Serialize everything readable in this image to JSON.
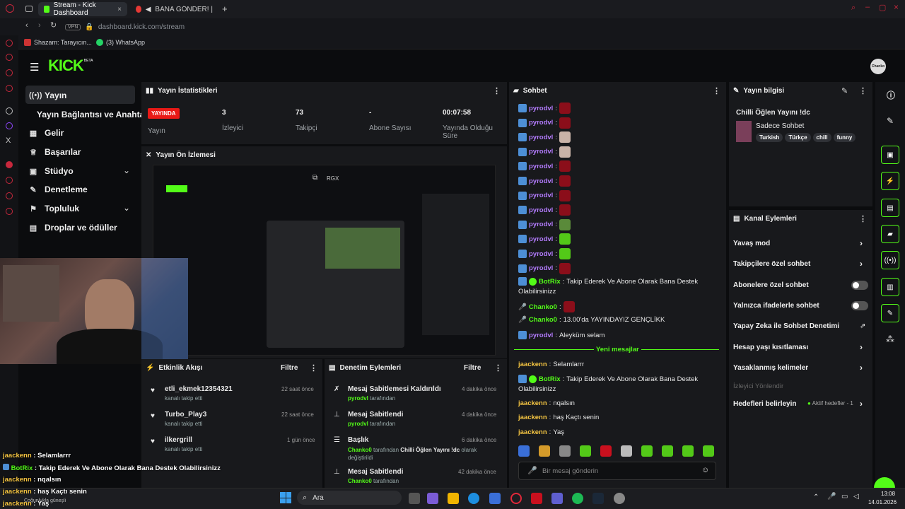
{
  "browser": {
    "tab1": "Stream - Kick Dashboard",
    "tab2": "BANA GÖNDER! | YouT",
    "url": "dashboard.kick.com/stream",
    "vpn": "VPN",
    "bookmark1": "Shazam: Tarayıcın...",
    "bookmark2": "(3) WhatsApp"
  },
  "logo": "KICK",
  "logo_beta": "BETA",
  "avatar": "Chanko",
  "nav": {
    "stream": "Yayın",
    "connection": "Yayın Bağlantısı ve Anahtarı",
    "income": "Gelir",
    "achievements": "Başarılar",
    "studio": "Stüdyo",
    "moderation": "Denetleme",
    "community": "Topluluk",
    "drops": "Droplar ve ödüller"
  },
  "stats": {
    "title": "Yayın İstatistikleri",
    "live_badge": "YAYINDA",
    "status_label": "Yayın",
    "viewers_value": "3",
    "viewers_label": "İzleyici",
    "followers_value": "73",
    "followers_label": "Takipçi",
    "subs_value": "-",
    "subs_label": "Abone Sayısı",
    "duration_value": "00:07:58",
    "duration_label": "Yayında Olduğu Süre"
  },
  "preview": {
    "title": "Yayın Ön İzlemesi",
    "rgx": "RGX"
  },
  "activity": {
    "title": "Etkinlik Akışı",
    "filter": "Filtre",
    "items": [
      {
        "user": "etli_ekmek12354321",
        "action": "kanalı takip etti",
        "time": "22 saat önce"
      },
      {
        "user": "Turbo_Play3",
        "action": "kanalı takip etti",
        "time": "22 saat önce"
      },
      {
        "user": "ilkergrill",
        "action": "kanalı takip etti",
        "time": "1 gün önce"
      }
    ]
  },
  "modactions": {
    "title": "Denetim Eylemleri",
    "filter": "Filtre",
    "items": [
      {
        "title": "Mesaj Sabitlemesi Kaldırıldı",
        "by": "pyrodvl",
        "suffix": "tarafından",
        "time": "4 dakika önce"
      },
      {
        "title": "Mesaj Sabitlendi",
        "by": "pyrodvl",
        "suffix": "tarafından",
        "time": "4 dakika önce"
      },
      {
        "title": "Başlık",
        "by": "Chanko0",
        "suffix": "tarafından",
        "extra": "Chilli Öğlen Yayını !dc",
        "extra2": "olarak",
        "extra3": "değiştirildi",
        "time": "6 dakika önce"
      },
      {
        "title": "Mesaj Sabitlendi",
        "by": "Chanko0",
        "suffix": "tarafından",
        "time": "42 dakika önce"
      }
    ]
  },
  "chat": {
    "title": "Sohbet",
    "pyro": "pyrodvl",
    "botrix": "BotRix",
    "botmsg1": "Takip Ederek Ve Abone Olarak Bana Destek",
    "botmsg2": "Olabilirsinizz",
    "chanko": "Chanko0",
    "chanko_msg": "13.00'da YAYINDAYIZ GENÇLİKK",
    "pyro_msg": "Aleyküm selam",
    "new_msgs": "Yeni mesajlar",
    "jaeckenn": "jaackenn",
    "m1": "Selamlarrr",
    "m3": "nqalsın",
    "m4": "haş Kaçtı senin",
    "m5": "Yaş",
    "placeholder": "Bir mesaj gönderin"
  },
  "info": {
    "title": "Yayın bilgisi",
    "stream_title": "Chilli Öğlen Yayını !dc",
    "category": "Sadece Sohbet",
    "tags": [
      "Turkish",
      "Türkçe",
      "chill",
      "funny"
    ]
  },
  "channel": {
    "title": "Kanal Eylemleri",
    "slow": "Yavaş mod",
    "followers": "Takipçilere özel sohbet",
    "subs": "Abonelere özel sohbet",
    "emotes": "Yalnızca ifadelerle sohbet",
    "ai": "Yapay Zeka ile Sohbet Denetimi",
    "age": "Hesap yaşı kısıtlaması",
    "banned": "Yasaklanmış kelimeler",
    "redirect": "İzleyici Yönlendir",
    "goals": "Hedefleri belirleyin",
    "goals_status": "Aktif hedefler - 1"
  },
  "overlay": {
    "l1u": "jaackenn",
    "l1": "Selamlarrr",
    "l2u": "BotRix",
    "l2": "Takip Ederek Ve Abone Olarak Bana Destek Olabilirsinizz",
    "l3u": "jaackenn",
    "l3": "nqalsın",
    "l4u": "jaackenn",
    "l4": "haş Kaçtı senin",
    "l5u": "jaackenn",
    "l5": "Yaş",
    "weather": "Çoğunlukla güneşli"
  },
  "taskbar": {
    "search": "Ara",
    "time": "13:08",
    "date": "14.01.2026"
  },
  "colors": {
    "accent": "#53fc18",
    "live": "#e91916",
    "pyro": "#b47cff",
    "bot": "#53fc18",
    "chanko": "#53fc18",
    "jaeckenn": "#f5c542"
  }
}
